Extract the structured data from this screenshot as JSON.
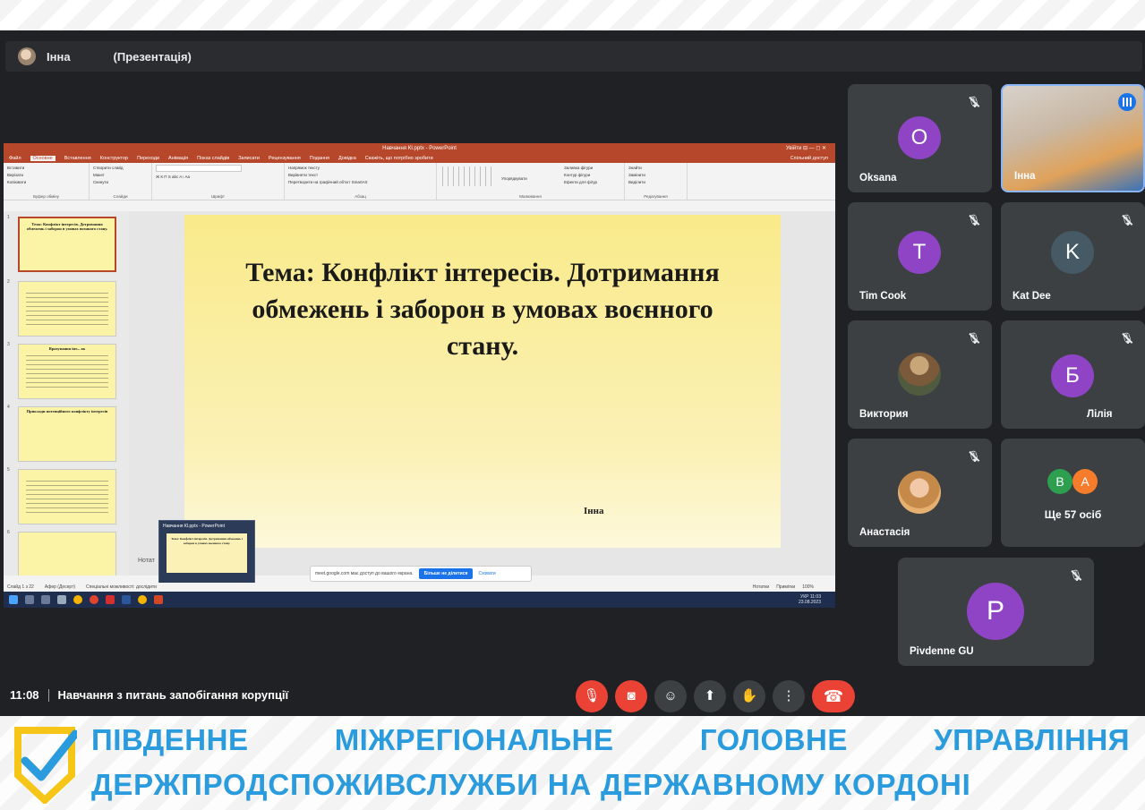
{
  "presenter": {
    "name": "Інна",
    "status": "(Презентація)"
  },
  "powerpoint": {
    "window_title": "Навчання КІ.pptx  -  PowerPoint",
    "window_buttons": "Увійти   ⊟   —   ◻   ✕",
    "tabs": [
      "Файл",
      "Основне",
      "Вставлення",
      "Конструктор",
      "Переходи",
      "Анімація",
      "Показ слайдів",
      "Записати",
      "Рецензування",
      "Подання",
      "Довідка",
      "Скажіть, що потрібно зробити"
    ],
    "share_label": "Спільний доступ",
    "ribbon_groups": [
      {
        "label": "Буфер обміну",
        "items": [
          "Вставити",
          "Вирізати",
          "Копіювати",
          "Формат за зразком"
        ]
      },
      {
        "label": "Слайди",
        "items": [
          "Створити слайд",
          "Макет",
          "Скинути",
          "Розділ"
        ]
      },
      {
        "label": "Шрифт",
        "items": [
          "Ж  К  П  S  abc  A↕  Aa",
          "A  A"
        ]
      },
      {
        "label": "Абзац",
        "items": [
          "Напрямок тексту",
          "Вирівняти текст",
          "Перетворити на графічний об'єкт SmartArt"
        ]
      },
      {
        "label": "Малювання",
        "items": [
          "Упорядкувати",
          "Експрес-стилі",
          "Заливка фігури",
          "Контур фігури",
          "Ефекти для фігур"
        ]
      },
      {
        "label": "Редагування",
        "items": [
          "Знайти",
          "Замінити",
          "Виділити"
        ]
      }
    ],
    "thumb_numbers": [
      "1",
      "2",
      "3",
      "4",
      "5",
      "6"
    ],
    "thumb1_text": "Тема: Конфлікт інтересів. Дотримання обмежень і заборон в умовах воєнного стану.",
    "thumb3_title": "Врахування інт... ак",
    "thumb4_title": "Приклади потенційного конфлікту інтересів",
    "slide": {
      "title": "Тема: Конфлікт інтересів. Дотримання обмежень і заборон в умовах воєнного стану.",
      "author": "Інна"
    },
    "notes_label": "Нотат",
    "status_left": [
      "Слайд 1 з 22",
      "Афер (Десерт)",
      "Спеціальні можливості: дослідити"
    ],
    "status_right": [
      "Нотатки",
      "Примітки",
      "100%"
    ],
    "share_bar": {
      "text": "meet.google.com має доступ до вашого екрана.",
      "button": "Більше не ділитися",
      "link": "Сховати"
    },
    "preview_title": "Навчання КІ.pptx - PowerPoint",
    "preview_text": "Тема: Конфлікт інтересів. Дотримання обмежень і заборон в умовах воєнного стану.",
    "tray": {
      "lang": "УКР",
      "time": "11:03",
      "date": "23.08.2023"
    }
  },
  "participants": [
    {
      "name": "Oksana",
      "initial": "O",
      "color": "#8e44c4"
    },
    {
      "name": "Інна",
      "speaking": true
    },
    {
      "name": "Tim Cook",
      "initial": "T",
      "color": "#8e44c4"
    },
    {
      "name": "Kat Dee",
      "initial": "K",
      "color": "#455a64"
    },
    {
      "name": "Виктория"
    },
    {
      "name": "Лілія",
      "initial": "Б",
      "color": "#8e44c4"
    },
    {
      "name": "Анастасія"
    },
    {
      "more_label": "Ще 57 осіб",
      "initials": [
        "B",
        "A"
      ],
      "colors": [
        "#2e9e4f",
        "#f57c2a"
      ]
    },
    {
      "name": "Pivdenne GU",
      "initial": "P",
      "color": "#8e44c4"
    }
  ],
  "meeting": {
    "time": "11:08",
    "title": "Навчання з питань запобігання корупції"
  },
  "controls": [
    "mic-off",
    "camera-off",
    "emoji",
    "present",
    "raise-hand",
    "more",
    "end-call"
  ],
  "banner": {
    "line1": [
      "ПІВДЕННЕ",
      "МІЖРЕГІОНАЛЬНЕ",
      "ГОЛОВНЕ",
      "УПРАВЛІННЯ"
    ],
    "line2": "ДЕРЖПРОДСПОЖИВСЛУЖБИ НА ДЕРЖАВНОМУ КОРДОНІ",
    "color": "#2a9bdc"
  }
}
